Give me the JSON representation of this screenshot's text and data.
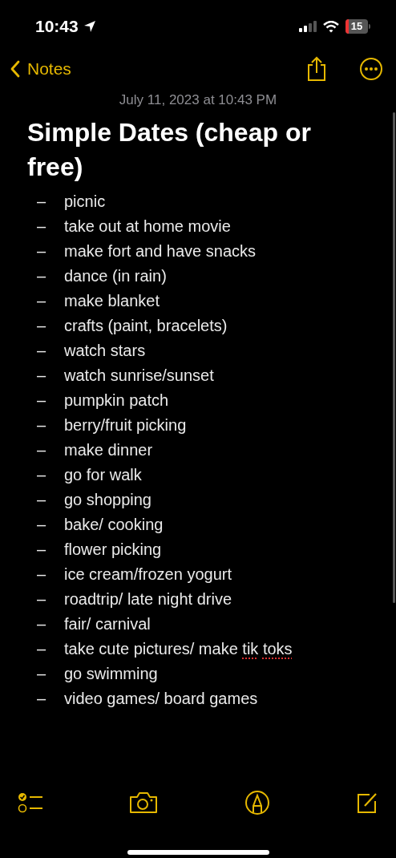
{
  "status_bar": {
    "time": "10:43",
    "battery": "15"
  },
  "nav": {
    "back_label": "Notes"
  },
  "note": {
    "date": "July 11, 2023 at 10:43 PM",
    "title": "Simple Dates (cheap or free)",
    "items": [
      {
        "bullet": "–",
        "segments": [
          {
            "text": "picnic",
            "misspelled": false
          }
        ]
      },
      {
        "bullet": "–",
        "segments": [
          {
            "text": "take out at home movie",
            "misspelled": false
          }
        ]
      },
      {
        "bullet": "–",
        "segments": [
          {
            "text": "make fort and have snacks",
            "misspelled": false
          }
        ]
      },
      {
        "bullet": "–",
        "segments": [
          {
            "text": "dance (in rain)",
            "misspelled": false
          }
        ]
      },
      {
        "bullet": "–",
        "segments": [
          {
            "text": "make blanket",
            "misspelled": false
          }
        ]
      },
      {
        "bullet": "–",
        "segments": [
          {
            "text": "crafts (paint, bracelets)",
            "misspelled": false
          }
        ]
      },
      {
        "bullet": "–",
        "segments": [
          {
            "text": "watch stars",
            "misspelled": false
          }
        ]
      },
      {
        "bullet": "–",
        "segments": [
          {
            "text": "watch sunrise/sunset",
            "misspelled": false
          }
        ]
      },
      {
        "bullet": "–",
        "segments": [
          {
            "text": "pumpkin patch",
            "misspelled": false
          }
        ]
      },
      {
        "bullet": "–",
        "segments": [
          {
            "text": "berry/fruit picking",
            "misspelled": false
          }
        ]
      },
      {
        "bullet": "–",
        "segments": [
          {
            "text": "make dinner",
            "misspelled": false
          }
        ]
      },
      {
        "bullet": "–",
        "segments": [
          {
            "text": "go for walk",
            "misspelled": false
          }
        ]
      },
      {
        "bullet": "–",
        "segments": [
          {
            "text": "go shopping",
            "misspelled": false
          }
        ]
      },
      {
        "bullet": "–",
        "segments": [
          {
            "text": "bake/ cooking",
            "misspelled": false
          }
        ]
      },
      {
        "bullet": "–",
        "segments": [
          {
            "text": "flower picking",
            "misspelled": false
          }
        ]
      },
      {
        "bullet": "–",
        "segments": [
          {
            "text": "ice cream/frozen yogurt",
            "misspelled": false
          }
        ]
      },
      {
        "bullet": "–",
        "segments": [
          {
            "text": "roadtrip/ late night drive",
            "misspelled": false
          }
        ]
      },
      {
        "bullet": "–",
        "segments": [
          {
            "text": "fair/ carnival",
            "misspelled": false
          }
        ]
      },
      {
        "bullet": "–",
        "segments": [
          {
            "text": "take cute pictures/ make ",
            "misspelled": false
          },
          {
            "text": "tik",
            "misspelled": true
          },
          {
            "text": "toks",
            "misspelled": true
          }
        ]
      },
      {
        "bullet": "–",
        "segments": [
          {
            "text": "go swimming",
            "misspelled": false
          }
        ]
      },
      {
        "bullet": "–",
        "segments": [
          {
            "text": "video games/ board games",
            "misspelled": false
          }
        ]
      }
    ]
  }
}
